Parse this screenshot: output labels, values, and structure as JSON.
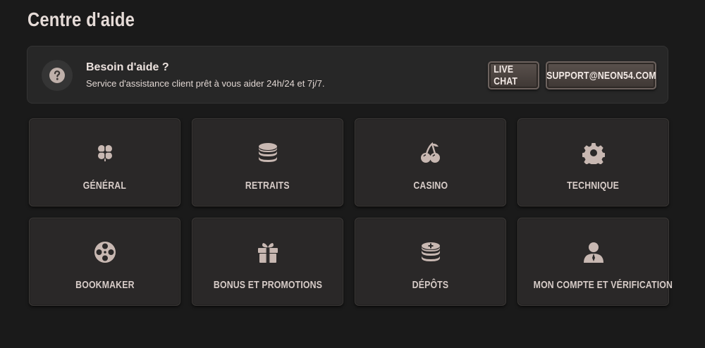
{
  "page": {
    "title": "Centre d'aide"
  },
  "help": {
    "title": "Besoin d'aide ?",
    "subtitle": "Service d'assistance client prêt à vous aider 24h/24 et 7j/7.",
    "live_chat_label": "LIVE CHAT",
    "email_label": "SUPPORT@NEON54.COM",
    "icon": "question-circle-icon"
  },
  "categories": [
    {
      "label": "GÉNÉRAL",
      "icon": "clover-icon"
    },
    {
      "label": "RETRAITS",
      "icon": "coin-stack-icon"
    },
    {
      "label": "CASINO",
      "icon": "cherries-icon"
    },
    {
      "label": "TECHNIQUE",
      "icon": "gear-icon"
    },
    {
      "label": "BOOKMAKER",
      "icon": "film-reel-icon"
    },
    {
      "label": "BONUS ET PROMOTIONS",
      "icon": "gift-icon"
    },
    {
      "label": "DÉPÔTS",
      "icon": "coin-stack-plus-icon"
    },
    {
      "label": "MON COMPTE ET VÉRIFICATION",
      "icon": "user-icon"
    }
  ],
  "colors": {
    "background": "#1a1a1a",
    "panel": "#272727",
    "card": "#2a2828",
    "icon": "#c8b8b2",
    "text": "#e6dcd8"
  }
}
